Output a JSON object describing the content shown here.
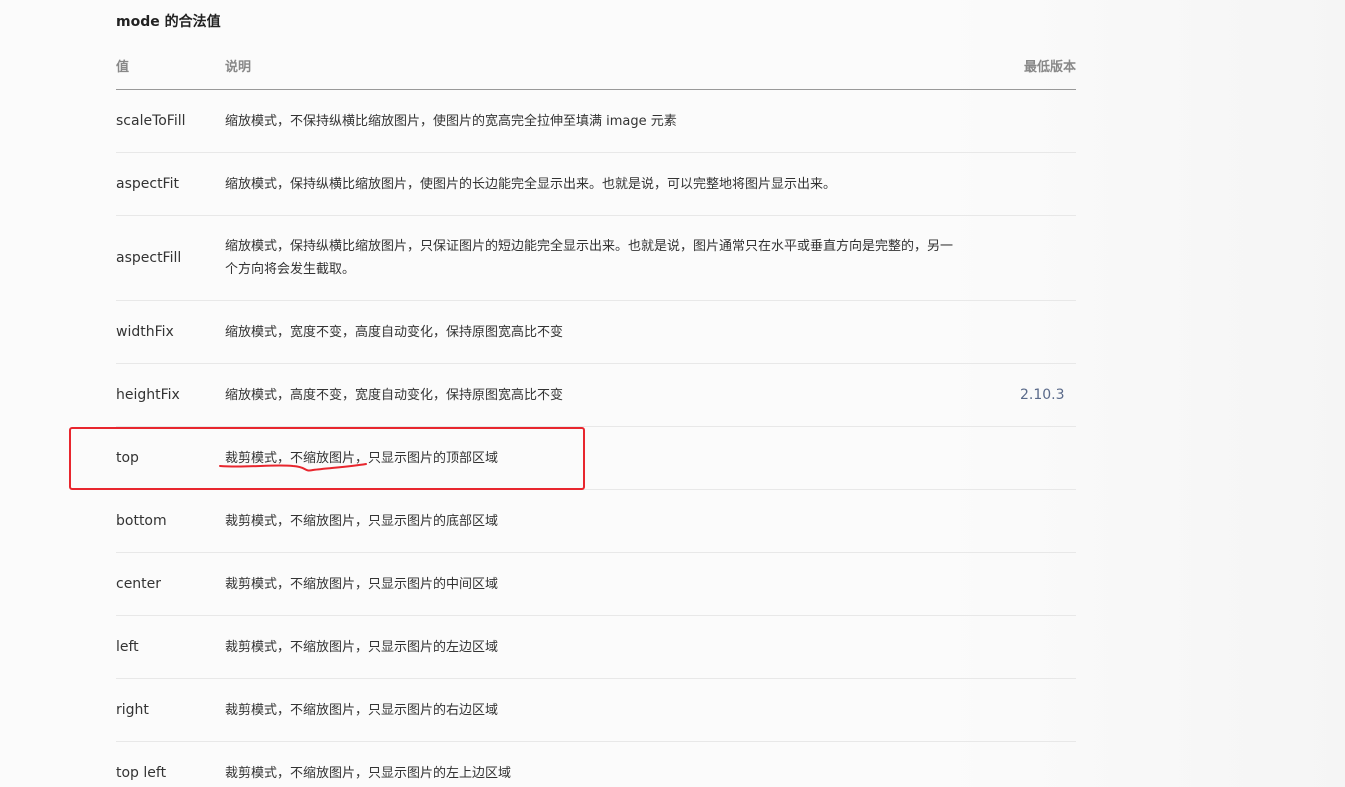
{
  "section": {
    "title": "mode 的合法值"
  },
  "table": {
    "headers": {
      "value": "值",
      "description": "说明",
      "min_version": "最低版本"
    },
    "rows": [
      {
        "value": "scaleToFill",
        "description": "缩放模式，不保持纵横比缩放图片，使图片的宽高完全拉伸至填满 image 元素",
        "min_version": ""
      },
      {
        "value": "aspectFit",
        "description": "缩放模式，保持纵横比缩放图片，使图片的长边能完全显示出来。也就是说，可以完整地将图片显示出来。",
        "min_version": ""
      },
      {
        "value": "aspectFill",
        "description": "缩放模式，保持纵横比缩放图片，只保证图片的短边能完全显示出来。也就是说，图片通常只在水平或垂直方向是完整的，另一个方向将会发生截取。",
        "min_version": ""
      },
      {
        "value": "widthFix",
        "description": "缩放模式，宽度不变，高度自动变化，保持原图宽高比不变",
        "min_version": ""
      },
      {
        "value": "heightFix",
        "description": "缩放模式，高度不变，宽度自动变化，保持原图宽高比不变",
        "min_version": "2.10.3"
      },
      {
        "value": "top",
        "description": "裁剪模式，不缩放图片，只显示图片的顶部区域",
        "min_version": ""
      },
      {
        "value": "bottom",
        "description": "裁剪模式，不缩放图片，只显示图片的底部区域",
        "min_version": ""
      },
      {
        "value": "center",
        "description": "裁剪模式，不缩放图片，只显示图片的中间区域",
        "min_version": ""
      },
      {
        "value": "left",
        "description": "裁剪模式，不缩放图片，只显示图片的左边区域",
        "min_version": ""
      },
      {
        "value": "right",
        "description": "裁剪模式，不缩放图片，只显示图片的右边区域",
        "min_version": ""
      },
      {
        "value": "top left",
        "description": "裁剪模式，不缩放图片，只显示图片的左上边区域",
        "min_version": ""
      }
    ]
  },
  "annotations": {
    "highlight_color": "#e8262e",
    "highlighted_row": "top"
  }
}
